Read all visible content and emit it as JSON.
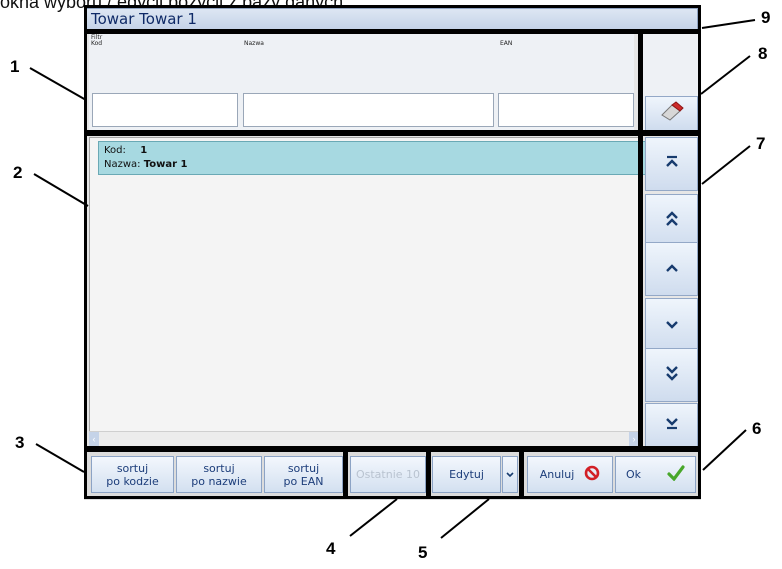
{
  "caption": "okna wyboru / edycji pozycji z bazy danych.",
  "window": {
    "title": "Towar Towar 1",
    "filter": {
      "label": "Filtr",
      "fields": [
        "Kod",
        "Nazwa",
        "EAN"
      ]
    },
    "list": {
      "items": [
        {
          "kod_label": "Kod:",
          "kod_value": "1",
          "nazwa_label": "Nazwa:",
          "nazwa_value": "Towar 1"
        }
      ]
    },
    "nav": {
      "first": "first-icon",
      "page_up": "double-chevron-up-icon",
      "up": "chevron-up-icon",
      "down": "chevron-down-icon",
      "page_down": "double-chevron-down-icon",
      "last": "last-icon",
      "clear": "eraser-icon"
    },
    "buttons": {
      "sort_code": [
        "sortuj",
        "po kodzie"
      ],
      "sort_name": [
        "sortuj",
        "po nazwie"
      ],
      "sort_ean": [
        "sortuj",
        "po EAN"
      ],
      "last10": "Ostatnie 10",
      "edit": "Edytuj",
      "cancel": "Anuluj",
      "ok": "Ok"
    }
  },
  "callouts": [
    "1",
    "2",
    "3",
    "4",
    "5",
    "6",
    "7",
    "8",
    "9"
  ],
  "colors": {
    "selected_row": "#a7d9e1",
    "accent_blue": "#1c3d7a",
    "cancel_red": "#d21f26",
    "ok_green": "#48a72b"
  }
}
